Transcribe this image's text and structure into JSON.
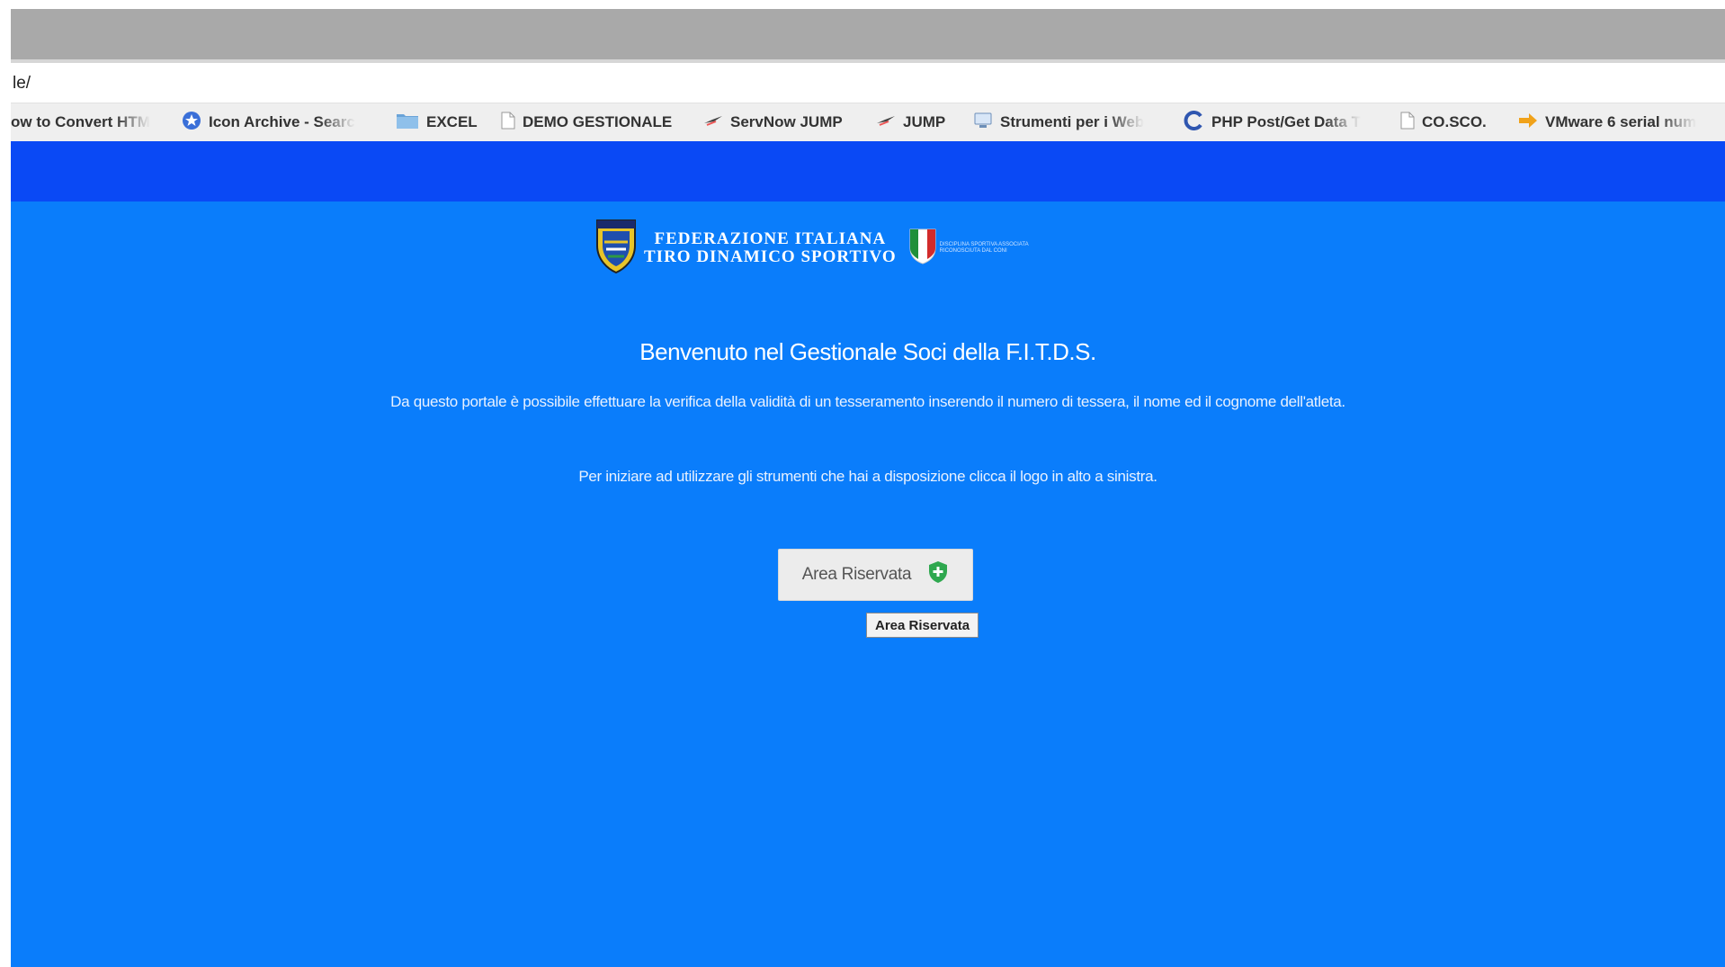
{
  "browser": {
    "address_text": "le/",
    "bookmarks": [
      {
        "label": "ow to Convert HTM",
        "icon": "page-icon"
      },
      {
        "label": "Icon Archive - Searc",
        "icon": "icon-archive-icon"
      },
      {
        "label": "EXCEL",
        "icon": "folder-icon"
      },
      {
        "label": "DEMO GESTIONALE",
        "icon": "page-icon"
      },
      {
        "label": "ServNow JUMP",
        "icon": "jump-icon"
      },
      {
        "label": "JUMP",
        "icon": "jump-icon"
      },
      {
        "label": "Strumenti per i Web",
        "icon": "web-tools-icon"
      },
      {
        "label": "PHP Post/Get Data T",
        "icon": "php-icon"
      },
      {
        "label": "CO.SCO.",
        "icon": "page-icon"
      },
      {
        "label": "VMware 6 serial num",
        "icon": "arrow-icon"
      }
    ]
  },
  "page": {
    "federation_line1": "FEDERAZIONE ITALIANA",
    "federation_line2": "TIRO DINAMICO SPORTIVO",
    "coni_text": "DISCIPLINA SPORTIVA ASSOCIATA RICONOSCIUTA DAL CONI",
    "welcome_title": "Benvenuto nel Gestionale Soci della F.I.T.D.S.",
    "intro_text": "Da questo portale è possibile effettuare la verifica della validità di un tesseramento inserendo il numero di tessera, il nome ed il cognome dell'atleta.",
    "instructions_text": "Per iniziare ad utilizzare gli strumenti che hai a disposizione clicca il logo in alto a sinistra.",
    "area_button_label": "Area Riservata",
    "tooltip_text": "Area Riservata"
  },
  "colors": {
    "navbar": "#0a49f5",
    "page_background": "#0a7dfb",
    "shield_green": "#2fa84f"
  }
}
